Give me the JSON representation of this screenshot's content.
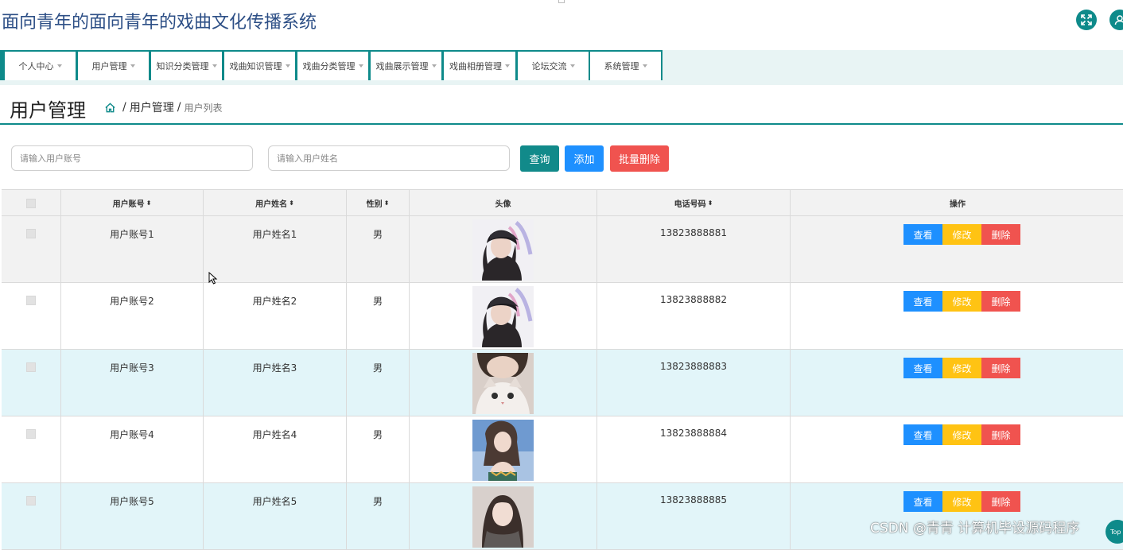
{
  "app": {
    "title": "面向青年的面向青年的戏曲文化传播系统"
  },
  "nav": {
    "items": [
      {
        "label": "个人中心"
      },
      {
        "label": "用户管理"
      },
      {
        "label": "知识分类管理"
      },
      {
        "label": "戏曲知识管理"
      },
      {
        "label": "戏曲分类管理"
      },
      {
        "label": "戏曲展示管理"
      },
      {
        "label": "戏曲相册管理"
      },
      {
        "label": "论坛交流"
      },
      {
        "label": "系统管理"
      }
    ]
  },
  "page": {
    "title": "用户管理",
    "breadcrumb": {
      "sep": "/",
      "section": "用户管理",
      "current": "用户列表"
    }
  },
  "search": {
    "account_placeholder": "请输入用户账号",
    "name_placeholder": "请输入用户姓名",
    "query_label": "查询",
    "add_label": "添加",
    "batch_delete_label": "批量删除"
  },
  "table": {
    "columns": {
      "account": "用户账号",
      "name": "用户姓名",
      "gender": "性别",
      "avatar": "头像",
      "phone": "电话号码",
      "actions": "操作"
    },
    "rows": [
      {
        "account": "用户账号1",
        "name": "用户姓名1",
        "gender": "男",
        "phone": "13823888881",
        "avatar_icon": "user-photo-cap"
      },
      {
        "account": "用户账号2",
        "name": "用户姓名2",
        "gender": "男",
        "phone": "13823888882",
        "avatar_icon": "user-photo-cap"
      },
      {
        "account": "用户账号3",
        "name": "用户姓名3",
        "gender": "男",
        "phone": "13823888883",
        "avatar_icon": "user-photo-cat"
      },
      {
        "account": "用户账号4",
        "name": "用户姓名4",
        "gender": "男",
        "phone": "13823888884",
        "avatar_icon": "user-photo-sky"
      },
      {
        "account": "用户账号5",
        "name": "用户姓名5",
        "gender": "男",
        "phone": "13823888885",
        "avatar_icon": "user-photo-scarf"
      }
    ],
    "row_actions": {
      "view": "查看",
      "edit": "修改",
      "delete": "删除"
    }
  },
  "watermark": "CSDN @青青  计算机毕设源码程序",
  "back_to_top": "Top",
  "colors": {
    "primary": "#0e8a8a",
    "title": "#2d4f86",
    "view": "#1e90ff",
    "edit": "#ffc313",
    "delete": "#f0534f",
    "row_hover": "#f2f2f2",
    "row_stripe": "#e2f5f9"
  }
}
